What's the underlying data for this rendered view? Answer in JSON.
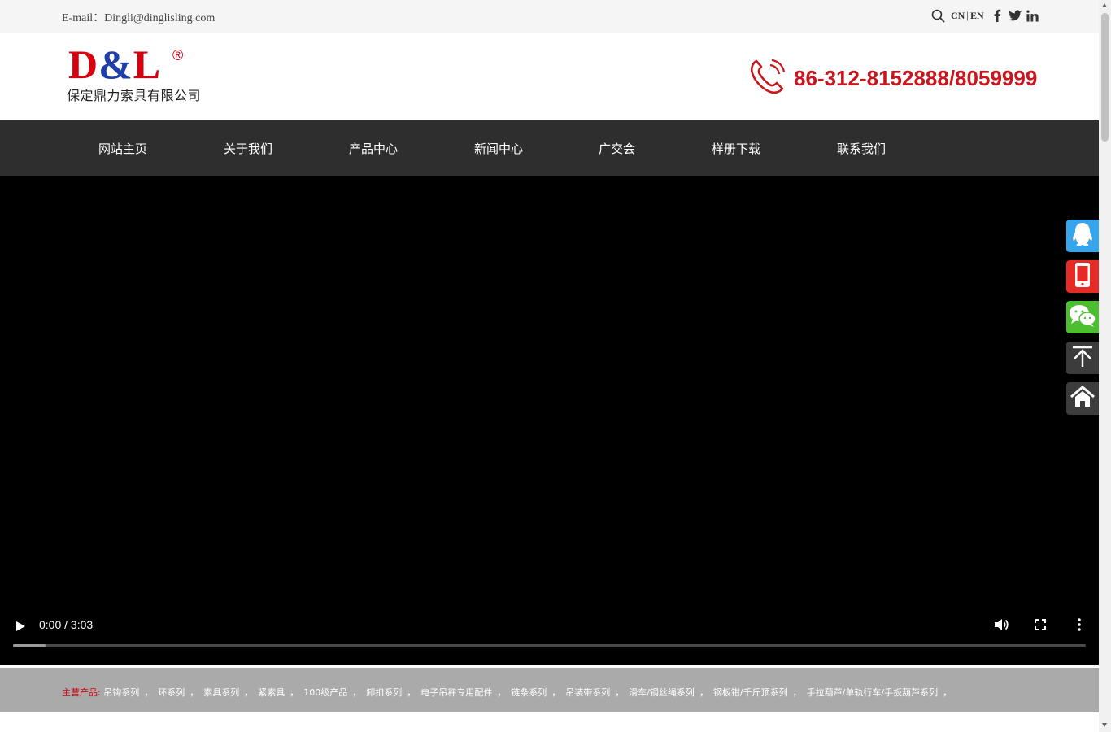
{
  "topbar": {
    "email": "E-mail：Dingli@dinglisling.com",
    "lang_cn": "CN",
    "lang_sep": "|",
    "lang_en": "EN",
    "icons": [
      "search-icon",
      "facebook-icon",
      "twitter-icon",
      "linkedin-icon"
    ]
  },
  "header": {
    "logo_mark_left": "D",
    "logo_mark_amp": "&",
    "logo_mark_right": "L",
    "logo_reg": "®",
    "logo_company": "保定鼎力索具有限公司",
    "phone": "86-312-8152888/8059999"
  },
  "nav": {
    "items": [
      "网站主页",
      "关于我们",
      "产品中心",
      "新闻中心",
      "广交会",
      "样册下载",
      "联系我们"
    ]
  },
  "video": {
    "time": "0:00 / 3:03",
    "buffered_fraction": 0.03
  },
  "products": {
    "label": "主营产品:",
    "items": [
      "吊钩系列",
      "环系列",
      "索具系列",
      "紧索具",
      "100级产品",
      "卸扣系列",
      "电子吊秤专用配件",
      "链条系列",
      "吊装带系列",
      "滑车/钢丝绳系列",
      "钢板钳/千斤顶系列",
      "手拉葫芦/单轨行车/手扳葫芦系列"
    ],
    "separator": "，"
  },
  "float_bar": {
    "items": [
      "qq-icon",
      "mobile-phone-icon",
      "wechat-icon",
      "back-to-top-icon",
      "home-icon"
    ]
  },
  "colors": {
    "brand_red": "#d7000f",
    "phone_red": "#c8161d",
    "nav_bg": "#2e2e2e",
    "qq_blue": "#37a5ec",
    "mobile_red": "#e52b25",
    "wechat_green": "#4cbf30",
    "dark_button": "#3c3c3c"
  }
}
